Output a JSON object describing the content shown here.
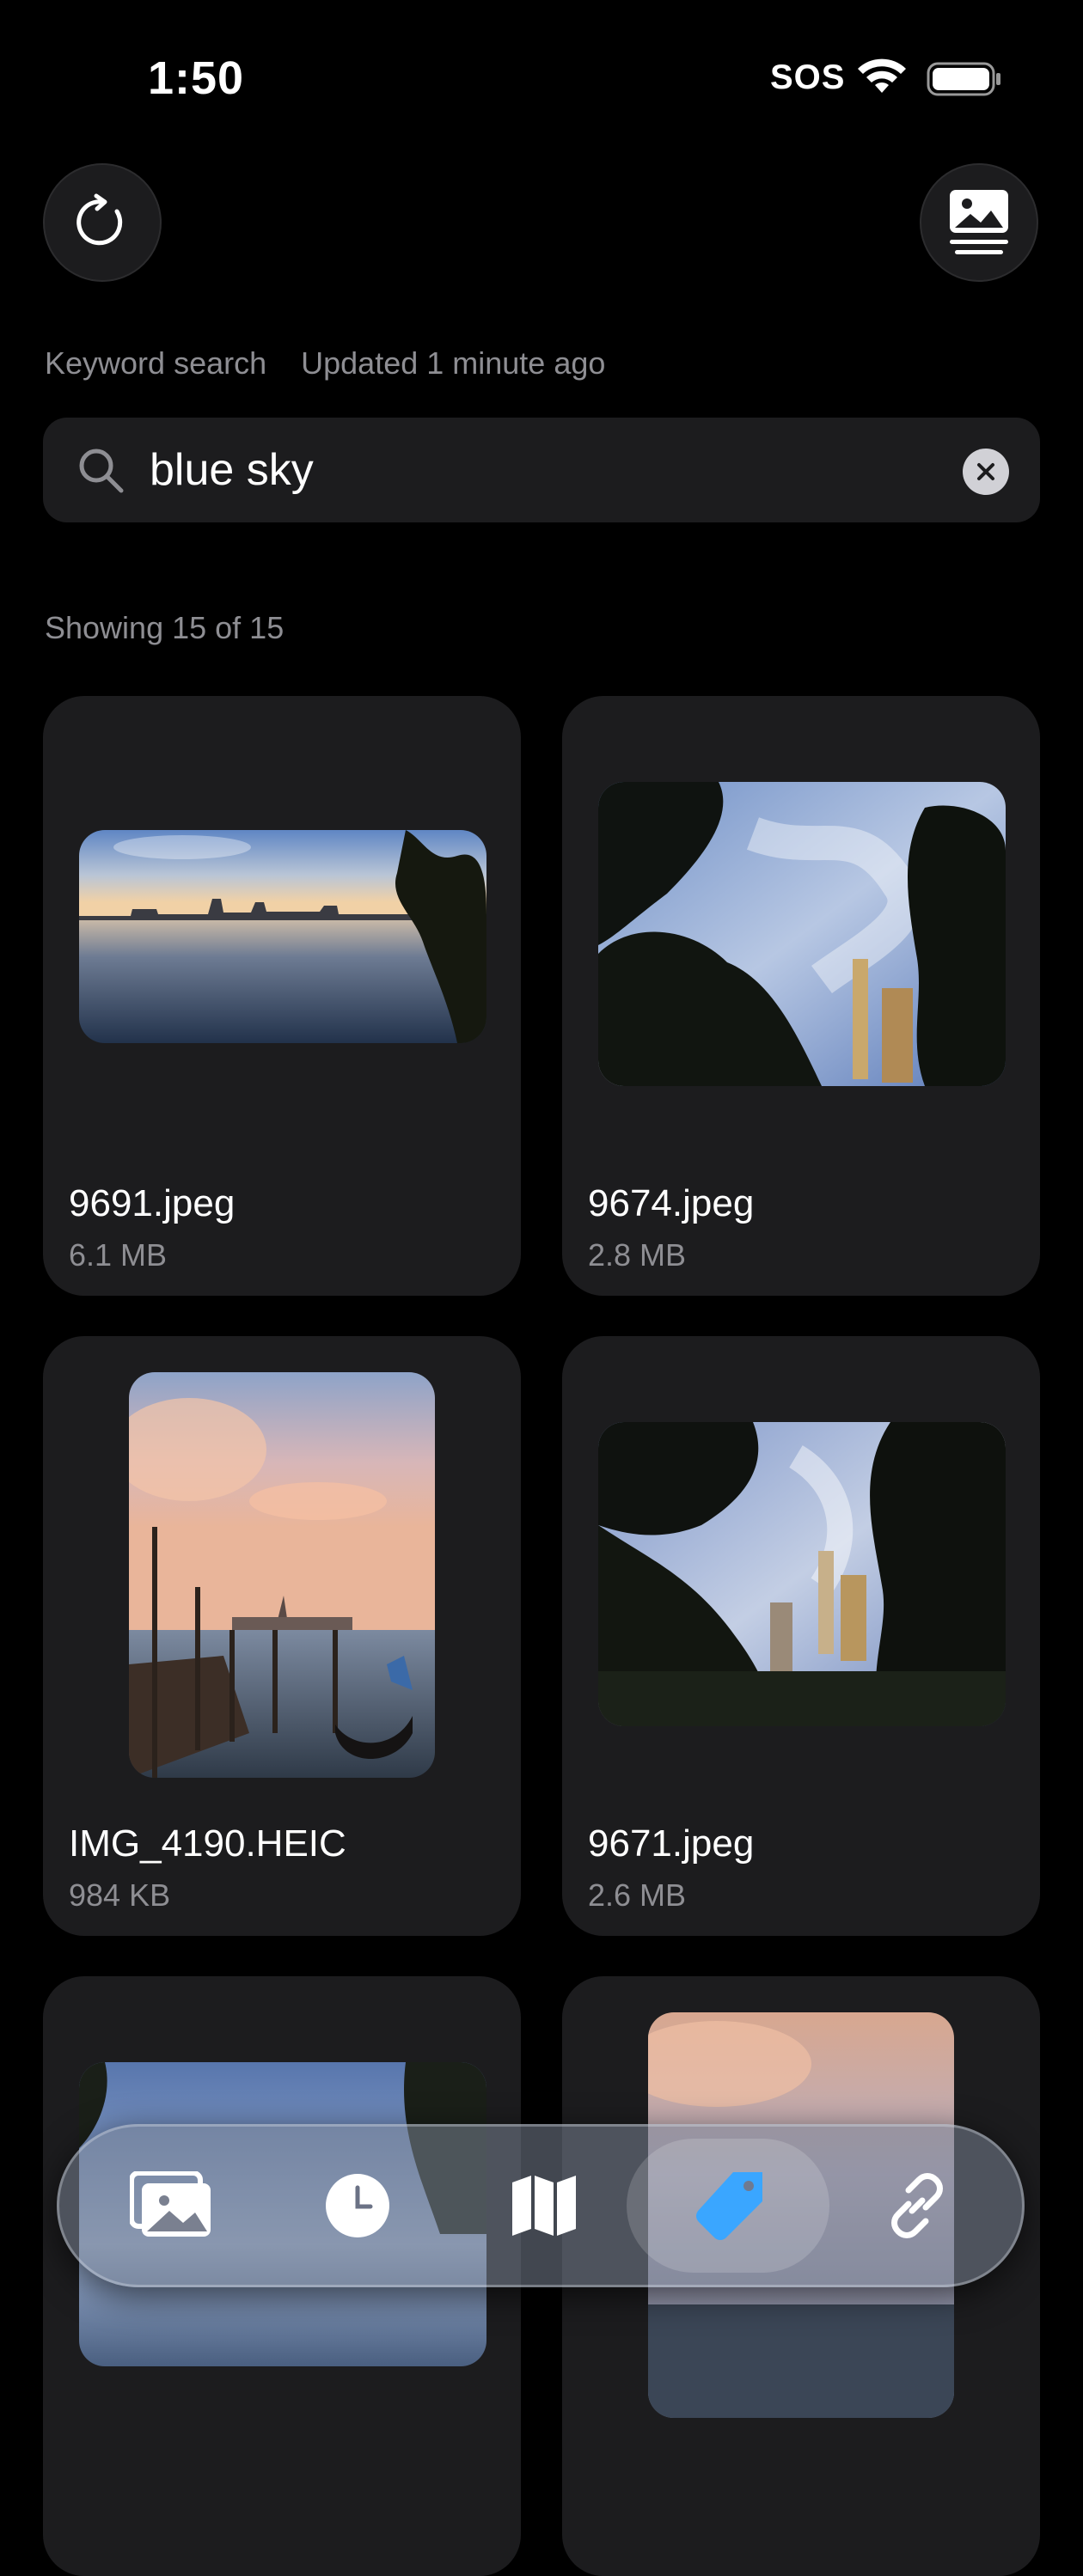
{
  "status_bar": {
    "time": "1:50",
    "carrier": "SOS",
    "icons": [
      "wifi-icon",
      "battery-icon"
    ]
  },
  "header": {
    "refresh_icon": "refresh-icon",
    "gallery_icon": "gallery-list-icon"
  },
  "meta": {
    "mode": "Keyword search",
    "updated": "Updated 1 minute ago"
  },
  "search": {
    "value": "blue sky",
    "placeholder": ""
  },
  "results": {
    "summary": "Showing 15 of 15",
    "items": [
      {
        "name": "9691.jpeg",
        "size": "6.1 MB"
      },
      {
        "name": "9674.jpeg",
        "size": "2.8 MB"
      },
      {
        "name": "IMG_4190.HEIC",
        "size": "984 KB"
      },
      {
        "name": "9671.jpeg",
        "size": "2.6 MB"
      },
      {
        "name": "",
        "size": ""
      },
      {
        "name": "",
        "size": ""
      }
    ]
  },
  "tab_bar": {
    "tabs": [
      {
        "icon": "photos-icon",
        "active": false
      },
      {
        "icon": "clock-icon",
        "active": false
      },
      {
        "icon": "map-icon",
        "active": false
      },
      {
        "icon": "tag-icon",
        "active": true
      },
      {
        "icon": "link-icon",
        "active": false
      }
    ]
  },
  "colors": {
    "background": "#000000",
    "card": "#1c1c1e",
    "secondary_text": "#8e8e93",
    "accent": "#3aa6ff"
  }
}
